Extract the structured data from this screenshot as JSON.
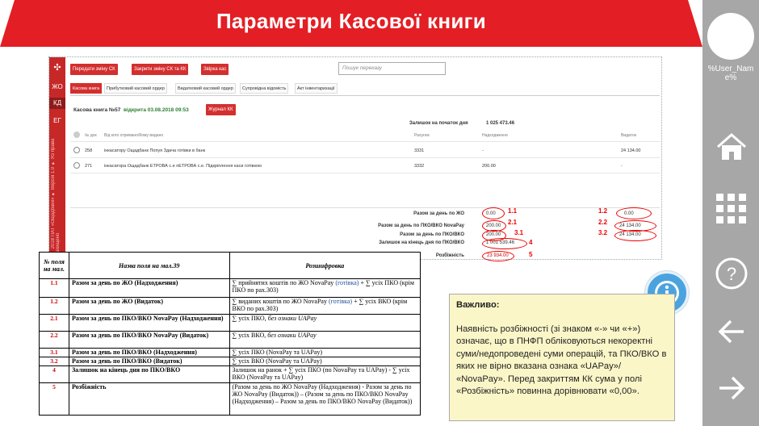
{
  "header": {
    "title": "Параметри Касової книги"
  },
  "rightbar": {
    "username": "%User_Name%",
    "icons": [
      "home-icon",
      "menu-grid-icon",
      "help-icon",
      "back-arrow-icon",
      "forward-arrow-icon"
    ]
  },
  "screenshot": {
    "sidebar": {
      "logo": "✣",
      "items": [
        "ЖО",
        "КД",
        "ЕГ"
      ],
      "active": "КД",
      "vertical_text": "© 2018 ПАТ «Ощадбанк» ● Версія 1.0 ● Усі права захищено"
    },
    "toolbar": {
      "buttons": [
        "Передати зміну СК",
        "Закрити зміну СК та КК",
        "Звірка кас"
      ],
      "search_placeholder": "Пошук переказу"
    },
    "tabs": [
      "Касова книга",
      "Прибутковий касовий ордер",
      "Видатковий касовий ордер",
      "Супровідна відомість",
      "Акт інвентаризації"
    ],
    "book": {
      "title": "Касова книга №57",
      "status": "відкрита 03.08.2018 09:53",
      "journal_btn": "Журнал КК"
    },
    "opening": {
      "label": "Залишок на початок дня",
      "value": "1 025 473.46"
    },
    "columns": {
      "acc": "Рахунок",
      "in": "Надходження",
      "out": "Видаток",
      "doc": "№ док",
      "who": "Від кого отримано/Кому видано"
    },
    "rows": [
      {
        "doc": "258",
        "who": "інкасатору Ощадбанк Попуя Здача готівки в банк",
        "acc": "3331",
        "in": "-",
        "out": "24 134.00"
      },
      {
        "doc": "271",
        "who": "інкасатора Ощадбанк ЕТРОВА с.е пЕТРОВА с.е. Підкріплення каси готівкою",
        "acc": "3332",
        "in": "200.00",
        "out": "-"
      }
    ],
    "totals": [
      {
        "label": "Разом за день по ЖО",
        "in": "0.00",
        "out": "0.00"
      },
      {
        "label": "Разом за день по ПКО/ВКО NovaPay",
        "in": "200.00",
        "out": "24 134.00"
      },
      {
        "label": "Разом за день по ПКО/ВКО",
        "in": "200.00",
        "out": "24 134.00"
      },
      {
        "label": "Залишок на кінець дня по ПКО/ВКО",
        "in": "1 001 539.46",
        "out": ""
      },
      {
        "label": "Розбіжність",
        "in": "23 934.00",
        "out": ""
      }
    ],
    "marks": {
      "m11": "1.1",
      "m12": "1.2",
      "m21": "2.1",
      "m22": "2.2",
      "m31": "3.1",
      "m32": "3.2",
      "m4": "4",
      "m5": "5"
    }
  },
  "table": {
    "headers": [
      "№ поля на мал.",
      "Назва поля на мал.39",
      "Розшифровка"
    ],
    "rows": [
      {
        "n": "1.1",
        "name": "Разом за день по ЖО (Надходження)",
        "d1": "∑ прийнятих коштів по ЖО NovaPay ",
        "d2": "(готівка)",
        "d3": " + ∑ усіх ПКО (крім ПКО по рах.303)"
      },
      {
        "n": "1.2",
        "name": "Разом за день по ЖО (Видаток)",
        "d1": "∑ виданих коштів по ЖО NovaPay ",
        "d2": "(готівка)",
        "d3": " + ∑ усіх ВКО (крім ВКО по рах.303)"
      },
      {
        "n": "2.1",
        "name": "Разом за день по ПКО/ВКО NovaPay (Надходження)",
        "d1": "∑ усіх ПКО, ",
        "d2": "",
        "d3": "без ознаки UAPay"
      },
      {
        "n": "2.2",
        "name": "Разом за день по ПКО/ВКО NovaPay (Видаток)",
        "d1": "∑ усіх ВКО, ",
        "d2": "",
        "d3": "без ознаки UAPay"
      },
      {
        "n": "3.1",
        "name": "Разом за день по ПКО/ВКО (Надходження)",
        "d1": "∑ усіх ПКО (NovaPay та UAPay)",
        "d2": "",
        "d3": ""
      },
      {
        "n": "3.2",
        "name": "Разом за день по ПКО/ВКО (Видаток)",
        "d1": "∑ усіх ВКО (NovaPay та UAPay)",
        "d2": "",
        "d3": ""
      },
      {
        "n": "4",
        "name": "Залишок на кінець дня по ПКО/ВКО",
        "d1": "Залишок на ранок + ∑ усіх ПКО (по NovaPay та UAPay) - ∑ усіх ВКО (NovaPay та UAPay)",
        "d2": "",
        "d3": ""
      },
      {
        "n": "5",
        "name": "Розбіжність",
        "d1": "(Разом за день по ЖО NovaPay (Надходження) - Разом за день по ЖО NovaPay (Видаток)) – (Разом за день по ПКО/ВКО NovaPay (Надходження) – Разом за день по ПКО/ВКО NovaPay (Видаток))",
        "d2": "",
        "d3": ""
      }
    ]
  },
  "note": {
    "title": "Важливо:",
    "body": "Наявність розбіжності (зі знаком «-» чи «+») означає, що в ПНФП обліковуються некоректні суми/недопроведені суми операцій, та ПКО/ВКО в яких не вірно вказана ознака «UAPay»/ «NovaPay». Перед закриттям КК сума у полі «Розбіжність» повинна дорівнювати «0,00»."
  }
}
